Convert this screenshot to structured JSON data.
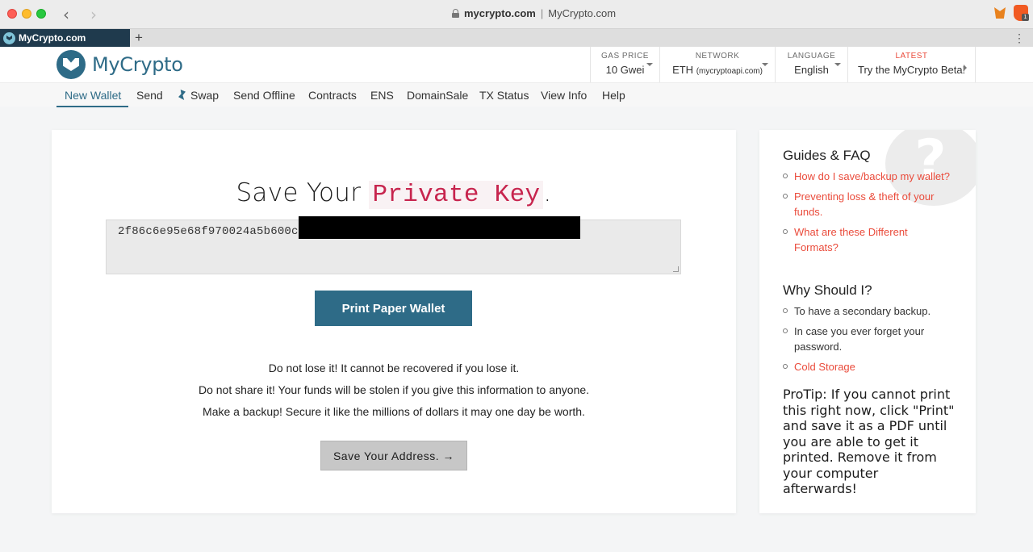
{
  "browser": {
    "url_domain": "mycrypto.com",
    "url_separator": "|",
    "page_title": "MyCrypto.com",
    "tab_label": "MyCrypto.com",
    "new_tab": "+",
    "tab_menu": "⋮",
    "back_glyph": "‹",
    "forward_glyph": "›",
    "extension_badge": "1"
  },
  "header": {
    "logo_text": "MyCrypto",
    "gas": {
      "label": "GAS PRICE",
      "value": "10 Gwei"
    },
    "network": {
      "label": "NETWORK",
      "value": "ETH",
      "detail": "(mycryptoapi.com)"
    },
    "language": {
      "label": "LANGUAGE",
      "value": "English"
    },
    "latest": {
      "label": "LATEST",
      "value": "Try the MyCrypto Beta!"
    }
  },
  "nav": {
    "items": [
      "New Wallet",
      "Send",
      "Swap",
      "Send Offline",
      "Contracts",
      "ENS",
      "DomainSale",
      "TX Status",
      "View Info",
      "Help"
    ],
    "active": "New Wallet"
  },
  "main": {
    "title_prefix": "Save Your",
    "title_code": "Private Key",
    "title_suffix": ".",
    "private_key_visible": "2f86c6e95e68f970024a5b600c",
    "print_button": "Print Paper Wallet",
    "warnings": [
      "Do not lose it! It cannot be recovered if you lose it.",
      "Do not share it! Your funds will be stolen if you give this information to anyone.",
      "Make a backup! Secure it like the millions of dollars it may one day be worth."
    ],
    "address_button": "Save Your Address. →"
  },
  "sidebar": {
    "faq_heading": "Guides & FAQ",
    "faq_links": [
      "How do I save/backup my wallet?",
      "Preventing loss & theft of your funds.",
      "What are these Different Formats?"
    ],
    "why_heading": "Why Should I?",
    "why_items": [
      "To have a secondary backup.",
      "In case you ever forget your password."
    ],
    "why_link": "Cold Storage",
    "protip": "ProTip: If you cannot print this right now, click \"Print\" and save it as a PDF until you are able to get it printed. Remove it from your computer afterwards!",
    "help_glyph": "?"
  },
  "colors": {
    "brand": "#2e6b87",
    "link": "#ea4b3b",
    "code": "#c7254e"
  }
}
